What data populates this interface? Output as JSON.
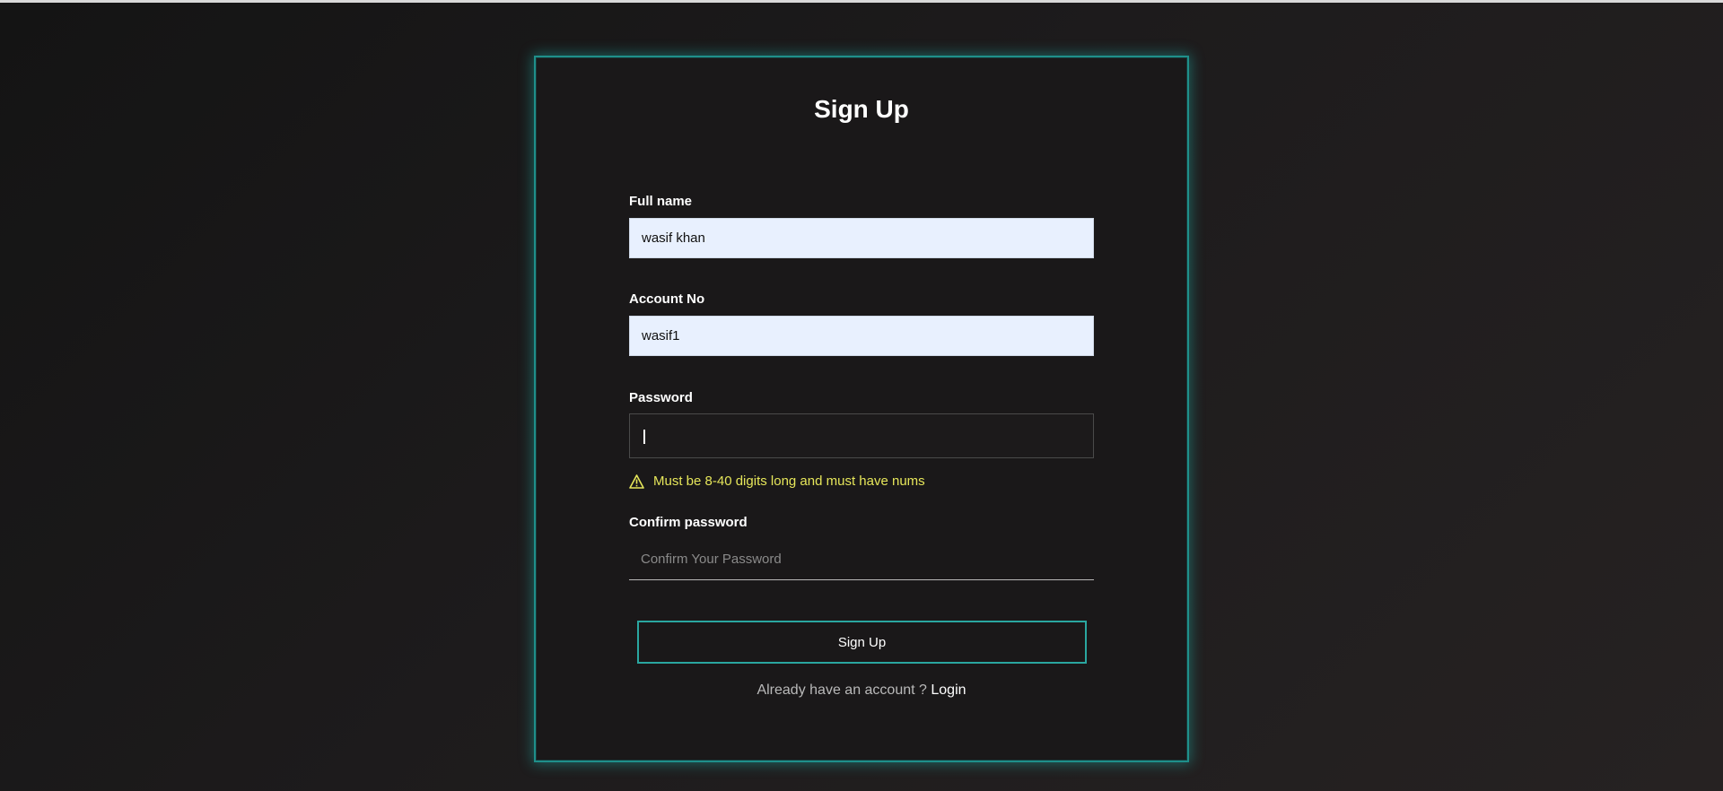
{
  "form": {
    "title": "Sign Up",
    "full_name": {
      "label": "Full name",
      "value": "wasif khan"
    },
    "account_no": {
      "label": "Account No",
      "value": "wasif1"
    },
    "password": {
      "label": "Password",
      "value": "",
      "warning": "Must be 8-40 digits long and must have nums"
    },
    "confirm_password": {
      "label": "Confirm password",
      "value": "",
      "placeholder": "Confirm Your Password"
    },
    "submit_label": "Sign Up",
    "footer": {
      "text": "Already have an account ?",
      "link_label": "Login"
    }
  },
  "colors": {
    "accent": "#2aa6a0",
    "warning": "#e6e65a",
    "filled_input_bg": "#e8f0fe"
  },
  "icons": {
    "warning": "warning-triangle-icon"
  }
}
